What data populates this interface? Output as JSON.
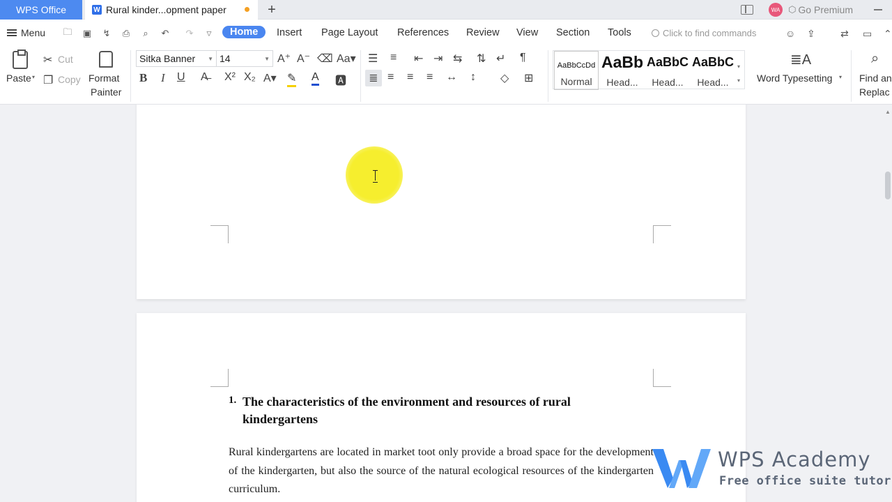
{
  "tabs": {
    "home_tab": "WPS Office",
    "doc_tab": "Rural kinder...opment paper",
    "doc_icon_letter": "W",
    "add_tab": "+"
  },
  "titlebar": {
    "avatar_initials": "WA",
    "premium": "Go Premium"
  },
  "menubar": {
    "menu": "Menu",
    "tabs": [
      "Home",
      "Insert",
      "Page Layout",
      "References",
      "Review",
      "View",
      "Section",
      "Tools"
    ],
    "active_tab": "Home",
    "search_placeholder": "Click to find commands"
  },
  "ribbon": {
    "paste": "Paste",
    "cut": "Cut",
    "copy": "Copy",
    "format_painter_1": "Format",
    "format_painter_2": "Painter",
    "font_name": "Sitka Banner",
    "font_size": "14",
    "bold": "B",
    "italic": "I",
    "underline": "U",
    "styles": [
      {
        "sample": "AaBbCcDd",
        "caption": "Normal"
      },
      {
        "sample": "AaBb",
        "caption": "Head..."
      },
      {
        "sample": "AaBbC",
        "caption": "Head..."
      },
      {
        "sample": "AaBbC",
        "caption": "Head..."
      }
    ],
    "word_typesetting": "Word Typesetting",
    "find_replace_1": "Find an",
    "find_replace_2": "Replac"
  },
  "document": {
    "heading_number": "1.",
    "heading": "The characteristics of the environment and resources of rural kindergartens",
    "paragraph": "Rural kindergartens are located in market toot only provide a broad space for the development of the kindergarten, but also the source of the natural ecological resources of the kindergarten curriculum."
  },
  "watermark": {
    "title": "WPS Academy",
    "subtitle": "Free office suite tutorials"
  },
  "colors": {
    "accent": "#4a86f0",
    "wps_tab": "#4d8af0",
    "highlight": "#f6ee2e"
  }
}
